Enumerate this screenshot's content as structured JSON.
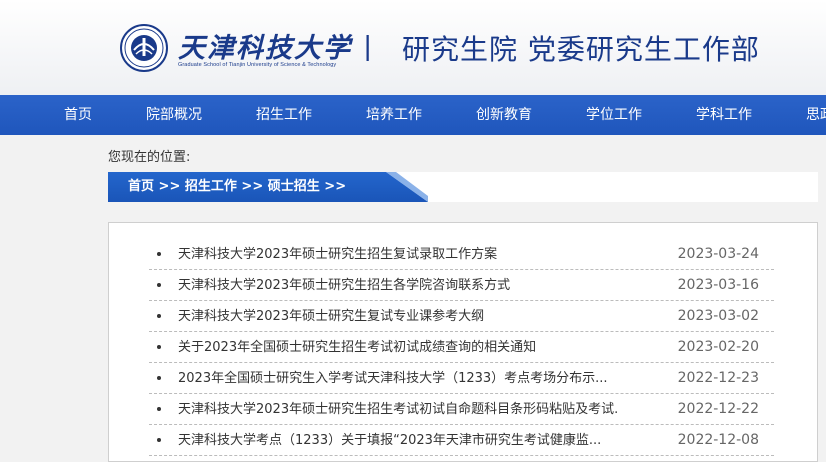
{
  "header": {
    "logo_cn": "天津科技大学",
    "logo_en": "Graduate School of Tianjin University of Science & Technology",
    "separator": "|",
    "site_title": "研究生院  党委研究生工作部"
  },
  "nav": {
    "items": [
      "首页",
      "院部概况",
      "招生工作",
      "培养工作",
      "创新教育",
      "学位工作",
      "学科工作",
      "思政"
    ]
  },
  "location": {
    "label": "您现在的位置:",
    "crumbs": [
      "首页",
      "招生工作",
      "硕士招生"
    ],
    "separator": ">>"
  },
  "list": [
    {
      "title": "天津科技大学2023年硕士研究生招生复试录取工作方案",
      "date": "2023-03-24"
    },
    {
      "title": "天津科技大学2023年硕士研究生招生各学院咨询联系方式",
      "date": "2023-03-16"
    },
    {
      "title": "天津科技大学2023年硕士研究生复试专业课参考大纲",
      "date": "2023-03-02"
    },
    {
      "title": "关于2023年全国硕士研究生招生考试初试成绩查询的相关通知",
      "date": "2023-02-20"
    },
    {
      "title": "2023年全国硕士研究生入学考试天津科技大学（1233）考点考场分布示...",
      "date": "2022-12-23"
    },
    {
      "title": "天津科技大学2023年硕士研究生招生考试初试自命题科目条形码粘贴及考试...",
      "date": "2022-12-22"
    },
    {
      "title": "天津科技大学考点（1233）关于填报“2023年天津市研究生考试健康监...",
      "date": "2022-12-08"
    }
  ],
  "colors": {
    "brand_blue": "#1a3a8a",
    "nav_blue": "#2b63c9",
    "crumb_blue": "#1f5fc4"
  }
}
